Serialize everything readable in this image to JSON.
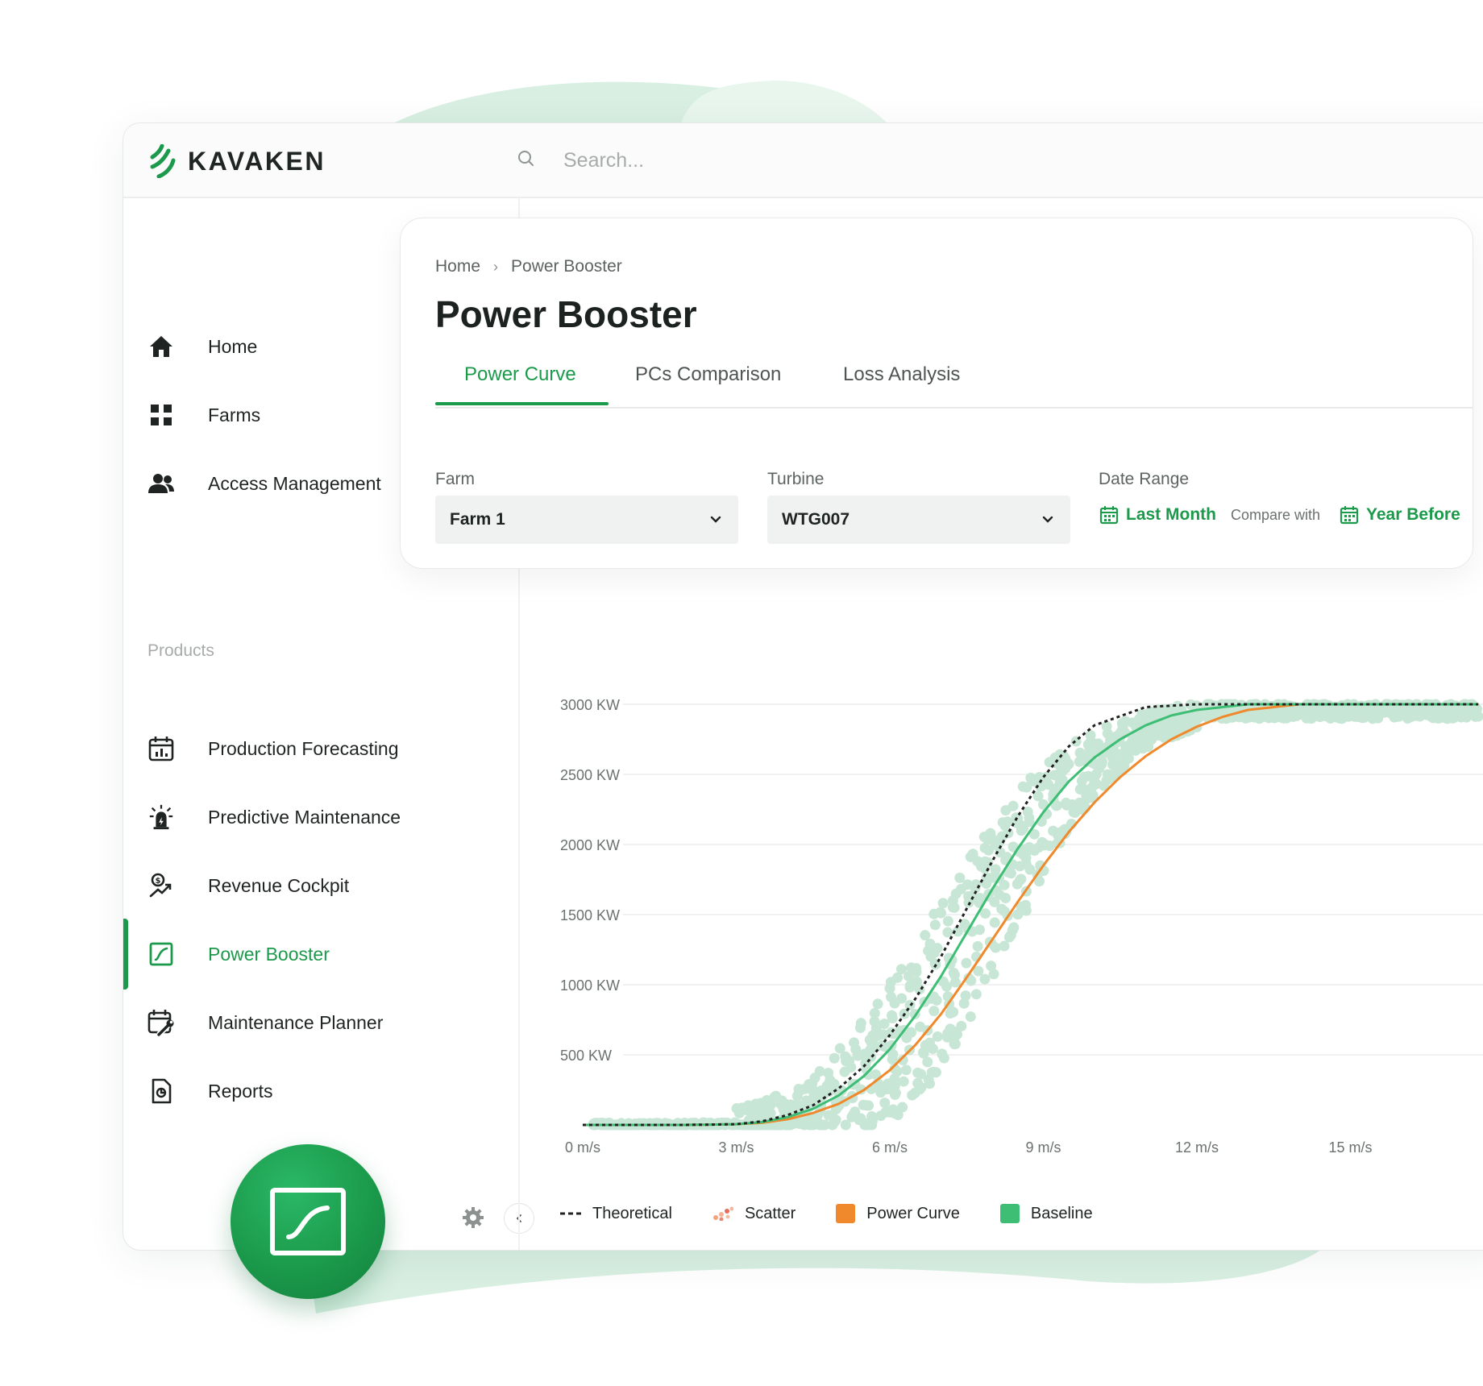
{
  "app": {
    "logo_text": "KAVAKEN"
  },
  "search": {
    "placeholder": "Search..."
  },
  "sidebar": {
    "items": [
      {
        "label": "Home",
        "icon": "home-icon"
      },
      {
        "label": "Farms",
        "icon": "grid-icon"
      },
      {
        "label": "Access Management",
        "icon": "users-icon"
      }
    ],
    "section_label": "Products",
    "products": [
      {
        "label": "Production Forecasting",
        "icon": "calendar-chart-icon"
      },
      {
        "label": "Predictive Maintenance",
        "icon": "alert-light-icon"
      },
      {
        "label": "Revenue Cockpit",
        "icon": "revenue-icon"
      },
      {
        "label": "Power Booster",
        "icon": "power-curve-icon",
        "active": true
      },
      {
        "label": "Maintenance Planner",
        "icon": "calendar-wrench-icon"
      },
      {
        "label": "Reports",
        "icon": "report-icon"
      }
    ]
  },
  "page": {
    "breadcrumb": [
      "Home",
      "Power Booster"
    ],
    "title": "Power Booster",
    "tabs": [
      "Power Curve",
      "PCs Comparison",
      "Loss Analysis"
    ],
    "active_tab": "Power Curve"
  },
  "filters": {
    "farm": {
      "label": "Farm",
      "value": "Farm 1"
    },
    "turbine": {
      "label": "Turbine",
      "value": "WTG007"
    },
    "date_range": {
      "label": "Date Range",
      "primary": "Last Month",
      "compare_label": "Compare with",
      "secondary": "Year Before"
    }
  },
  "colors": {
    "accent": "#1b9a4b",
    "scatter": "#c8e6d5",
    "power_curve": "#f0892c",
    "baseline": "#3dbe74",
    "theoretical": "#222222"
  },
  "chart_data": {
    "type": "scatter",
    "x_ticks": [
      "0 m/s",
      "3 m/s",
      "6 m/s",
      "9 m/s",
      "12 m/s",
      "15 m/s"
    ],
    "y_ticks": [
      "500 KW",
      "1000 KW",
      "1500 KW",
      "2000 KW",
      "2500 KW",
      "3000 KW"
    ],
    "xlim": [
      0,
      17.5
    ],
    "ylim": [
      0,
      3000
    ],
    "grid": true,
    "legend_position": "bottom-left",
    "series": [
      {
        "name": "Theoretical",
        "style": "dashed",
        "x": [
          0,
          1,
          2,
          3,
          3.5,
          4,
          4.5,
          5,
          5.5,
          6,
          6.5,
          7,
          7.5,
          8,
          8.5,
          9,
          9.5,
          10,
          11,
          12,
          13,
          14,
          15,
          16,
          17.5
        ],
        "y": [
          0,
          0,
          0,
          5,
          25,
          70,
          140,
          260,
          420,
          640,
          900,
          1200,
          1540,
          1880,
          2200,
          2480,
          2700,
          2850,
          2980,
          3000,
          3000,
          3000,
          3000,
          3000,
          3000
        ]
      },
      {
        "name": "Scatter",
        "style": "points"
      },
      {
        "name": "Power Curve",
        "x": [
          0,
          1,
          2,
          3,
          3.5,
          4,
          4.5,
          5,
          5.5,
          6,
          6.5,
          7,
          7.5,
          8,
          8.5,
          9,
          9.5,
          10,
          10.5,
          11,
          11.5,
          12,
          12.5,
          13,
          14,
          15,
          16,
          17.5
        ],
        "y": [
          0,
          0,
          0,
          5,
          15,
          40,
          85,
          150,
          250,
          390,
          570,
          790,
          1050,
          1320,
          1590,
          1850,
          2090,
          2300,
          2480,
          2630,
          2750,
          2840,
          2910,
          2960,
          3000,
          3000,
          3000,
          3000
        ]
      },
      {
        "name": "Baseline",
        "x": [
          0,
          1,
          2,
          3,
          3.5,
          4,
          4.5,
          5,
          5.5,
          6,
          6.5,
          7,
          7.5,
          8,
          8.5,
          9,
          9.5,
          10,
          10.5,
          11,
          11.5,
          12,
          13,
          14,
          15,
          16,
          17.5
        ],
        "y": [
          0,
          0,
          0,
          5,
          20,
          55,
          115,
          210,
          350,
          540,
          780,
          1060,
          1370,
          1680,
          1970,
          2230,
          2450,
          2620,
          2750,
          2850,
          2920,
          2960,
          3000,
          3000,
          3000,
          3000,
          3000
        ]
      }
    ]
  }
}
